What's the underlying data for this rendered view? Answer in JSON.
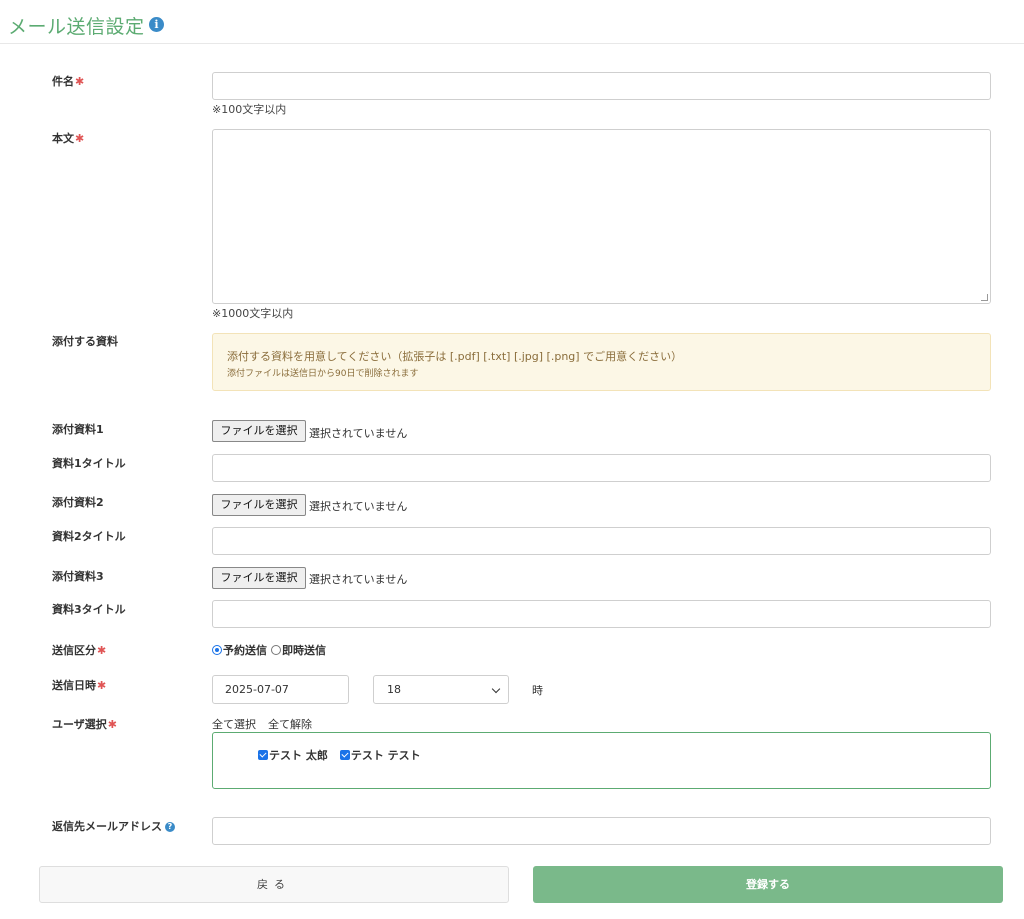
{
  "header": {
    "title": "メール送信設定",
    "info_icon": "i"
  },
  "required_mark": "✱",
  "subject": {
    "label": "件名",
    "value": "",
    "note": "※100文字以内"
  },
  "body": {
    "label": "本文",
    "value": "",
    "note": "※1000文字以内"
  },
  "attachments_info": {
    "label": "添付する資料",
    "message": "添付する資料を用意してください（拡張子は [.pdf] [.txt] [.jpg] [.png] でご用意ください）",
    "sub_message": "添付ファイルは送信日から90日で削除されます"
  },
  "files": [
    {
      "label": "添付資料1",
      "button": "ファイルを選択",
      "status": "選択されていません",
      "title_label": "資料1タイトル",
      "title_value": ""
    },
    {
      "label": "添付資料2",
      "button": "ファイルを選択",
      "status": "選択されていません",
      "title_label": "資料2タイトル",
      "title_value": ""
    },
    {
      "label": "添付資料3",
      "button": "ファイルを選択",
      "status": "選択されていません",
      "title_label": "資料3タイトル",
      "title_value": ""
    }
  ],
  "send_type": {
    "label": "送信区分",
    "options": [
      "予約送信",
      "即時送信"
    ],
    "selected": "予約送信"
  },
  "send_datetime": {
    "label": "送信日時",
    "date": "2025-07-07",
    "hour": "18",
    "hour_suffix": "時"
  },
  "user_select": {
    "label": "ユーザ選択",
    "select_all": "全て選択",
    "deselect_all": "全て解除",
    "users": [
      {
        "name": "テスト 太郎",
        "checked": true
      },
      {
        "name": "テスト テスト",
        "checked": true
      }
    ]
  },
  "reply_to": {
    "label": "返信先メールアドレス",
    "help_icon": "?",
    "value": ""
  },
  "buttons": {
    "back": "戻る",
    "submit": "登録する"
  },
  "colors": {
    "accent": "#5cab72",
    "submit": "#7ab98a",
    "required": "#e05555",
    "info": "#3a8bc8"
  }
}
